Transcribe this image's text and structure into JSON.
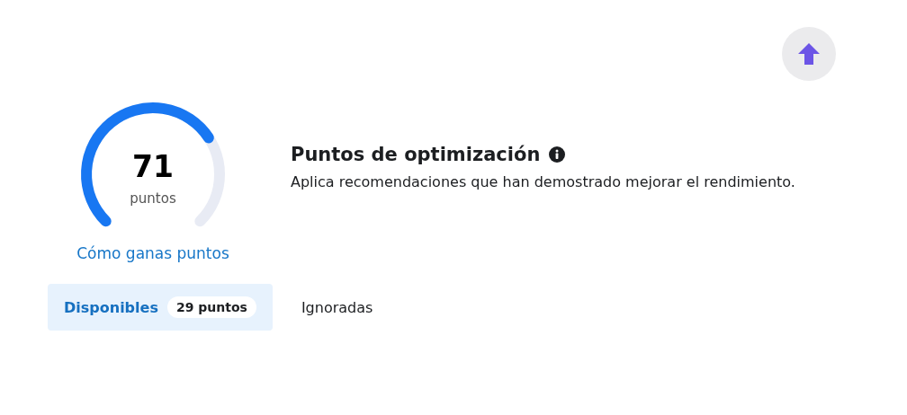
{
  "scroll_top_button": {
    "kind": "up"
  },
  "score": {
    "value": "71",
    "unit": "puntos",
    "link": "Cómo ganas puntos"
  },
  "header": {
    "title": "Puntos de optimización",
    "description": "Aplica recomendaciones que han demostrado mejorar el rendimiento."
  },
  "tabs": [
    {
      "label": "Disponibles",
      "badge": "29 puntos",
      "selected": true
    },
    {
      "label": "Ignoradas",
      "selected": false
    }
  ]
}
